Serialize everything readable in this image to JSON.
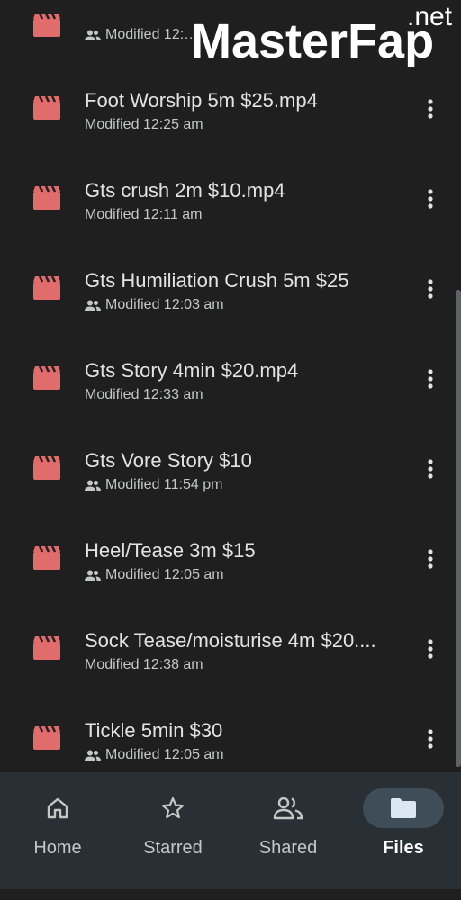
{
  "watermark": {
    "main": "MasterFap",
    "suffix": ".net"
  },
  "files": [
    {
      "name": "",
      "modified": "Modified 12:…",
      "shared": true
    },
    {
      "name": "Foot Worship 5m $25.mp4",
      "modified": "Modified 12:25 am",
      "shared": false
    },
    {
      "name": "Gts crush 2m $10.mp4",
      "modified": "Modified 12:11 am",
      "shared": false
    },
    {
      "name": "Gts Humiliation Crush 5m $25",
      "modified": "Modified 12:03 am",
      "shared": true
    },
    {
      "name": "Gts Story 4min $20.mp4",
      "modified": "Modified 12:33 am",
      "shared": false
    },
    {
      "name": "Gts Vore Story $10",
      "modified": "Modified 11:54 pm",
      "shared": true
    },
    {
      "name": "Heel/Tease 3m $15",
      "modified": "Modified 12:05 am",
      "shared": true
    },
    {
      "name": "Sock Tease/moisturise 4m $20....",
      "modified": "Modified 12:38 am",
      "shared": false
    },
    {
      "name": "Tickle 5min $30",
      "modified": "Modified 12:05 am",
      "shared": true
    }
  ],
  "nav": {
    "home": "Home",
    "starred": "Starred",
    "shared": "Shared",
    "files": "Files"
  },
  "colors": {
    "file_icon": "#e06c6c",
    "background": "#1f1f1f",
    "nav_bg": "#283035",
    "active_pill": "#3e4d57"
  }
}
